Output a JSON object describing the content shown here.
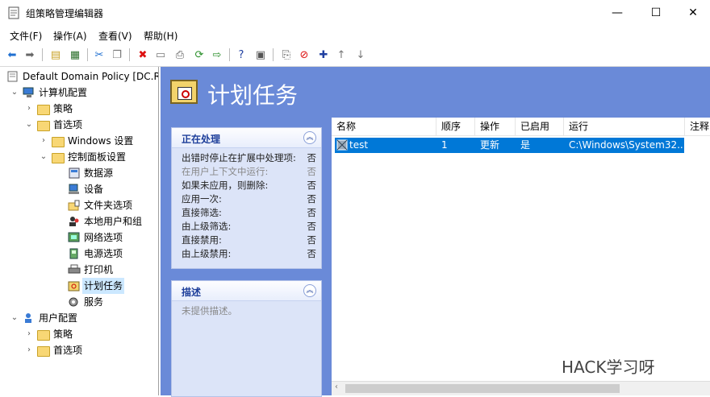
{
  "window": {
    "title": "组策略管理编辑器",
    "minimize": "—",
    "maximize": "☐",
    "close": "✕"
  },
  "menu": [
    "文件(F)",
    "操作(A)",
    "查看(V)",
    "帮助(H)"
  ],
  "tree": [
    {
      "label": "Default Domain Policy [DC.RE",
      "icon": "scroll-icon"
    },
    {
      "label": "计算机配置",
      "icon": "computer-icon"
    },
    {
      "label": "策略",
      "icon": "folder-icon"
    },
    {
      "label": "首选项",
      "icon": "folder-icon"
    },
    {
      "label": "Windows 设置",
      "icon": "folder-icon"
    },
    {
      "label": "控制面板设置",
      "icon": "control-panel-icon"
    },
    {
      "label": "数据源",
      "icon": "data-source-icon"
    },
    {
      "label": "设备",
      "icon": "device-icon"
    },
    {
      "label": "文件夹选项",
      "icon": "folder-options-icon"
    },
    {
      "label": "本地用户和组",
      "icon": "local-users-icon"
    },
    {
      "label": "网络选项",
      "icon": "network-icon"
    },
    {
      "label": "电源选项",
      "icon": "power-icon"
    },
    {
      "label": "打印机",
      "icon": "printer-icon"
    },
    {
      "label": "计划任务",
      "icon": "scheduled-task-icon"
    },
    {
      "label": "服务",
      "icon": "services-icon"
    },
    {
      "label": "用户配置",
      "icon": "user-icon"
    },
    {
      "label": "策略",
      "icon": "folder-icon"
    },
    {
      "label": "首选项",
      "icon": "folder-icon"
    }
  ],
  "header": {
    "title": "计划任务"
  },
  "processing": {
    "title": "正在处理",
    "rows": [
      {
        "label": "出错时停止在扩展中处理项:",
        "value": "否"
      },
      {
        "label": "在用户上下文中运行:",
        "value": "否"
      },
      {
        "label": "如果未应用，则删除:",
        "value": "否"
      },
      {
        "label": "应用一次:",
        "value": "否"
      },
      {
        "label": "直接筛选:",
        "value": "否"
      },
      {
        "label": "由上级筛选:",
        "value": "否"
      },
      {
        "label": "直接禁用:",
        "value": "否"
      },
      {
        "label": "由上级禁用:",
        "value": "否"
      }
    ]
  },
  "description": {
    "title": "描述",
    "text": "未提供描述。"
  },
  "list": {
    "columns": [
      "名称",
      "顺序",
      "操作",
      "已启用",
      "运行",
      "注释"
    ],
    "rows": [
      {
        "name": "test",
        "order": "1",
        "action": "更新",
        "enabled": "是",
        "run": "C:\\Windows\\System32..."
      }
    ]
  },
  "watermark": "HACK学习呀",
  "colors": {
    "accent": "#6a8ad8",
    "selection": "#0078d7"
  }
}
